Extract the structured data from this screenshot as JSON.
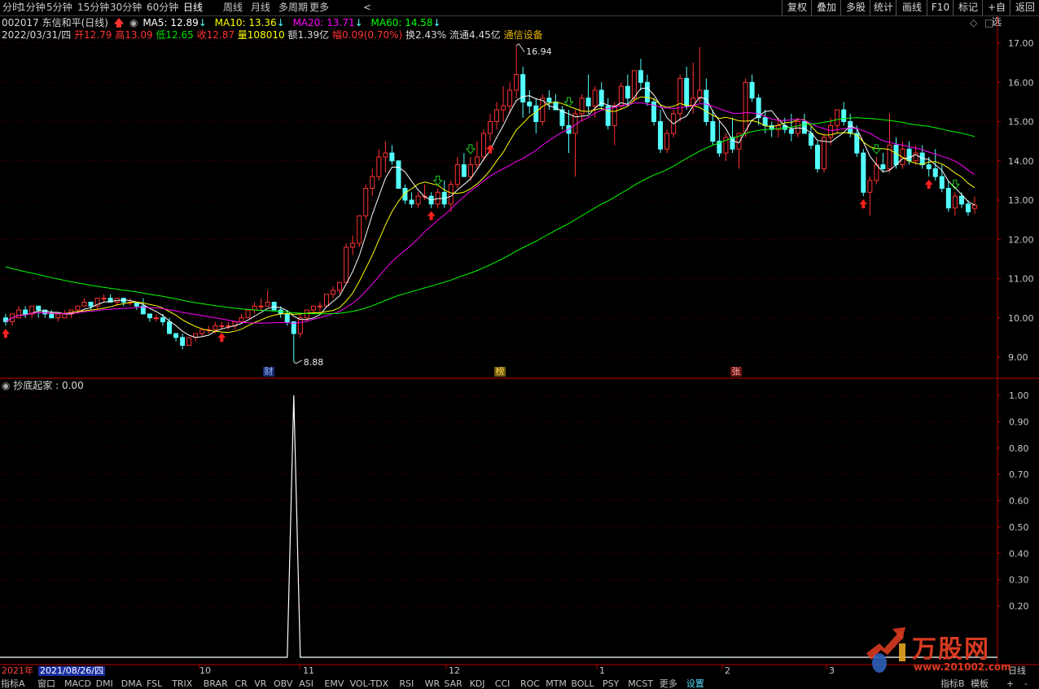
{
  "toolbar": {
    "periods": [
      "分时",
      "1分钟",
      "5分钟",
      "15分钟",
      "30分钟",
      "60分钟",
      "日线",
      "周线",
      "月线",
      "多周期",
      "更多"
    ],
    "active_period": "日线",
    "right_buttons": [
      "复权",
      "叠加",
      "多股",
      "统计",
      "画线",
      "F10",
      "标记",
      "+自选",
      "返回"
    ]
  },
  "header": {
    "title": "002017 东信和平(日线)",
    "ma5": "MA5: 12.89",
    "ma10": "MA10: 13.36",
    "ma20": "MA20: 13.71",
    "ma60": "MA60: 14.58",
    "date": "2022/03/31/四",
    "open": "开12.79",
    "high": "高13.09",
    "low": "低12.65",
    "close": "收12.87",
    "volume": "量108010",
    "amount": "额1.39亿",
    "change": "幅0.09(0.70%)",
    "turnover": "换2.43%",
    "float": "流通4.45亿",
    "industry": "通信设备"
  },
  "colors": {
    "up": "#ff3232",
    "down": "#54ffff",
    "ma5": "#ffffff",
    "ma10": "#ffff00",
    "ma20": "#ff00ff",
    "ma60": "#00ff00",
    "axis": "#c00000",
    "industry": "#e6b800"
  },
  "price_axis": [
    "17.00",
    "16.00",
    "15.00",
    "14.00",
    "13.00",
    "12.00",
    "11.00",
    "10.00",
    "9.00"
  ],
  "price_labels": {
    "high": "16.94",
    "low": "8.88"
  },
  "event_markers": [
    "财",
    "榜",
    "张"
  ],
  "indicator": {
    "title": "抄底起家 : 0.00",
    "axis": [
      "1.00",
      "0.90",
      "0.80",
      "0.70",
      "0.60",
      "0.50",
      "0.40",
      "0.30",
      "0.20"
    ]
  },
  "date_axis": {
    "year": "2021年",
    "cursor_date": "2021/08/26/四",
    "months": [
      "10",
      "11",
      "12",
      "1",
      "2",
      "3"
    ],
    "period_label": "日线"
  },
  "indicator_tabs": [
    "指标A",
    "窗口",
    "MACD",
    "DMI",
    "DMA",
    "FSL",
    "TRIX",
    "BRAR",
    "CR",
    "VR",
    "OBV",
    "ASI",
    "EMV",
    "VOL-TDX",
    "RSI",
    "WR",
    "SAR",
    "KDJ",
    "CCI",
    "ROC",
    "MTM",
    "BOLL",
    "PSY",
    "MCST",
    "更多",
    "设置"
  ],
  "right_tabs": [
    "指标B",
    "模板",
    "+",
    "-"
  ],
  "watermark": {
    "brand": "万股网",
    "url": "www.201002.com"
  },
  "chart_data": {
    "type": "candlestick",
    "title": "002017 东信和平(日线)",
    "ylim": [
      8.6,
      17.4
    ],
    "candles": [
      [
        10.0,
        10.1,
        9.8,
        9.9
      ],
      [
        9.9,
        10.1,
        9.8,
        10.1
      ],
      [
        10.0,
        10.3,
        10.0,
        10.2
      ],
      [
        10.2,
        10.3,
        10.0,
        10.1
      ],
      [
        10.1,
        10.3,
        10.0,
        10.3
      ],
      [
        10.3,
        10.3,
        10.0,
        10.2
      ],
      [
        10.2,
        10.2,
        10.0,
        10.1
      ],
      [
        10.1,
        10.2,
        10.0,
        10.0
      ],
      [
        10.0,
        10.1,
        9.9,
        10.1
      ],
      [
        10.0,
        10.2,
        10.0,
        10.1
      ],
      [
        10.1,
        10.2,
        10.0,
        10.2
      ],
      [
        10.2,
        10.3,
        10.1,
        10.3
      ],
      [
        10.3,
        10.5,
        10.3,
        10.4
      ],
      [
        10.4,
        10.4,
        10.2,
        10.3
      ],
      [
        10.3,
        10.5,
        10.2,
        10.5
      ],
      [
        10.5,
        10.6,
        10.4,
        10.5
      ],
      [
        10.5,
        10.6,
        10.4,
        10.4
      ],
      [
        10.4,
        10.5,
        10.3,
        10.5
      ],
      [
        10.5,
        10.5,
        10.3,
        10.4
      ],
      [
        10.4,
        10.5,
        10.3,
        10.4
      ],
      [
        10.4,
        10.4,
        10.2,
        10.3
      ],
      [
        10.3,
        10.5,
        10.1,
        10.1
      ],
      [
        10.1,
        10.1,
        9.9,
        10.0
      ],
      [
        10.0,
        10.1,
        9.9,
        10.0
      ],
      [
        10.0,
        10.1,
        9.8,
        9.9
      ],
      [
        9.9,
        10.0,
        9.6,
        9.6
      ],
      [
        9.6,
        9.6,
        9.4,
        9.5
      ],
      [
        9.5,
        9.6,
        9.2,
        9.3
      ],
      [
        9.3,
        9.5,
        9.3,
        9.5
      ],
      [
        9.5,
        9.6,
        9.4,
        9.6
      ],
      [
        9.6,
        9.7,
        9.5,
        9.7
      ],
      [
        9.7,
        9.8,
        9.6,
        9.7
      ],
      [
        9.7,
        9.9,
        9.6,
        9.8
      ],
      [
        9.8,
        9.9,
        9.7,
        9.8
      ],
      [
        9.8,
        9.9,
        9.7,
        9.8
      ],
      [
        9.8,
        9.9,
        9.7,
        9.9
      ],
      [
        9.9,
        10.1,
        9.9,
        10.0
      ],
      [
        10.0,
        10.2,
        10.0,
        10.2
      ],
      [
        10.2,
        10.4,
        10.1,
        10.3
      ],
      [
        10.3,
        10.5,
        10.2,
        10.3
      ],
      [
        10.3,
        10.7,
        10.3,
        10.4
      ],
      [
        10.4,
        10.4,
        10.2,
        10.2
      ],
      [
        10.2,
        10.3,
        10.0,
        10.1
      ],
      [
        10.1,
        10.2,
        9.8,
        9.9
      ],
      [
        9.9,
        9.9,
        8.88,
        9.6
      ],
      [
        9.6,
        10.1,
        9.5,
        10.0
      ],
      [
        10.0,
        10.2,
        9.9,
        10.2
      ],
      [
        10.2,
        10.3,
        10.1,
        10.3
      ],
      [
        10.3,
        10.4,
        10.1,
        10.3
      ],
      [
        10.3,
        10.6,
        10.3,
        10.6
      ],
      [
        10.6,
        10.8,
        10.5,
        10.7
      ],
      [
        10.7,
        10.9,
        10.6,
        10.9
      ],
      [
        10.9,
        11.9,
        10.9,
        11.8
      ],
      [
        11.8,
        12.1,
        11.6,
        11.9
      ],
      [
        11.9,
        12.6,
        11.8,
        12.6
      ],
      [
        12.6,
        13.4,
        12.5,
        13.3
      ],
      [
        13.3,
        13.8,
        13.1,
        13.6
      ],
      [
        13.6,
        14.3,
        13.5,
        14.1
      ],
      [
        14.1,
        14.5,
        13.7,
        14.2
      ],
      [
        14.2,
        14.4,
        13.9,
        14.0
      ],
      [
        14.0,
        14.0,
        13.3,
        13.3
      ],
      [
        13.3,
        13.4,
        12.9,
        13.0
      ],
      [
        13.0,
        13.2,
        12.8,
        12.9
      ],
      [
        12.9,
        13.2,
        12.8,
        13.1
      ],
      [
        13.1,
        13.4,
        13.0,
        13.1
      ],
      [
        13.1,
        13.2,
        12.8,
        12.9
      ],
      [
        12.9,
        13.3,
        12.8,
        13.2
      ],
      [
        13.2,
        13.5,
        12.8,
        12.9
      ],
      [
        12.9,
        13.5,
        12.7,
        13.4
      ],
      [
        13.4,
        14.1,
        13.3,
        13.9
      ],
      [
        13.9,
        14.2,
        13.6,
        13.6
      ],
      [
        13.6,
        14.1,
        13.5,
        13.9
      ],
      [
        13.9,
        14.5,
        13.8,
        14.1
      ],
      [
        14.1,
        14.8,
        14.0,
        14.7
      ],
      [
        14.7,
        15.2,
        14.5,
        15.0
      ],
      [
        15.0,
        15.5,
        14.8,
        15.3
      ],
      [
        15.3,
        15.9,
        15.0,
        15.4
      ],
      [
        15.4,
        16.0,
        15.2,
        15.8
      ],
      [
        15.8,
        16.94,
        15.6,
        16.2
      ],
      [
        16.2,
        16.4,
        15.1,
        15.5
      ],
      [
        15.5,
        15.8,
        15.2,
        15.4
      ],
      [
        15.4,
        15.6,
        14.7,
        15.0
      ],
      [
        15.0,
        15.7,
        14.9,
        15.6
      ],
      [
        15.6,
        15.8,
        15.3,
        15.5
      ],
      [
        15.5,
        15.7,
        15.3,
        15.3
      ],
      [
        15.3,
        15.4,
        14.8,
        14.9
      ],
      [
        14.9,
        15.3,
        14.2,
        14.7
      ],
      [
        14.7,
        15.3,
        13.6,
        15.2
      ],
      [
        15.2,
        15.7,
        15.0,
        15.6
      ],
      [
        15.6,
        16.2,
        15.2,
        15.4
      ],
      [
        15.4,
        15.9,
        15.1,
        15.8
      ],
      [
        15.8,
        16.0,
        15.3,
        15.4
      ],
      [
        15.4,
        15.6,
        14.8,
        14.9
      ],
      [
        14.9,
        15.5,
        14.4,
        15.4
      ],
      [
        15.4,
        16.0,
        15.3,
        15.9
      ],
      [
        15.9,
        16.2,
        15.4,
        15.6
      ],
      [
        15.6,
        16.3,
        15.5,
        16.3
      ],
      [
        16.3,
        16.6,
        15.8,
        16.0
      ],
      [
        16.0,
        16.2,
        15.4,
        15.5
      ],
      [
        15.5,
        15.6,
        14.9,
        15.0
      ],
      [
        15.0,
        15.3,
        14.2,
        14.3
      ],
      [
        14.3,
        14.8,
        14.2,
        14.7
      ],
      [
        14.7,
        15.3,
        14.6,
        15.2
      ],
      [
        15.2,
        16.2,
        15.0,
        16.1
      ],
      [
        16.1,
        16.4,
        15.3,
        15.4
      ],
      [
        15.4,
        16.5,
        15.2,
        15.6
      ],
      [
        15.6,
        16.9,
        15.5,
        15.8
      ],
      [
        15.8,
        16.1,
        14.9,
        15.0
      ],
      [
        15.0,
        15.3,
        14.4,
        14.5
      ],
      [
        14.5,
        15.0,
        14.1,
        14.2
      ],
      [
        14.2,
        14.7,
        14.0,
        14.6
      ],
      [
        14.6,
        15.1,
        14.2,
        14.3
      ],
      [
        14.3,
        14.6,
        13.8,
        14.7
      ],
      [
        14.7,
        16.1,
        14.6,
        16.0
      ],
      [
        16.0,
        16.2,
        15.5,
        15.6
      ],
      [
        15.6,
        15.7,
        14.9,
        15.1
      ],
      [
        15.1,
        15.3,
        14.7,
        14.9
      ],
      [
        14.9,
        15.0,
        14.6,
        14.8
      ],
      [
        14.8,
        15.1,
        14.6,
        14.9
      ],
      [
        14.9,
        15.1,
        14.7,
        14.8
      ],
      [
        14.8,
        15.2,
        14.5,
        14.7
      ],
      [
        14.7,
        15.1,
        14.6,
        15.0
      ],
      [
        15.0,
        15.2,
        14.7,
        14.7
      ],
      [
        14.7,
        14.9,
        14.3,
        14.4
      ],
      [
        14.4,
        14.5,
        13.7,
        13.8
      ],
      [
        13.8,
        14.7,
        13.7,
        14.6
      ],
      [
        14.6,
        15.1,
        14.4,
        14.9
      ],
      [
        14.9,
        15.3,
        14.7,
        15.3
      ],
      [
        15.3,
        15.5,
        14.9,
        15.0
      ],
      [
        15.0,
        15.2,
        14.6,
        14.7
      ],
      [
        14.7,
        14.9,
        14.1,
        14.2
      ],
      [
        14.2,
        14.3,
        13.1,
        13.2
      ],
      [
        13.2,
        13.6,
        12.6,
        13.5
      ],
      [
        13.5,
        14.1,
        13.4,
        13.9
      ],
      [
        13.9,
        14.2,
        13.7,
        13.8
      ],
      [
        13.8,
        15.2,
        13.7,
        14.4
      ],
      [
        14.4,
        14.6,
        13.8,
        13.9
      ],
      [
        13.9,
        14.5,
        13.8,
        14.3
      ],
      [
        14.3,
        14.5,
        13.9,
        14.0
      ],
      [
        14.0,
        14.4,
        13.9,
        14.2
      ],
      [
        14.2,
        14.4,
        13.8,
        13.9
      ],
      [
        13.9,
        14.1,
        13.6,
        13.8
      ],
      [
        13.8,
        14.3,
        13.5,
        13.6
      ],
      [
        13.6,
        13.9,
        13.2,
        13.3
      ],
      [
        13.3,
        13.5,
        12.7,
        12.8
      ],
      [
        12.8,
        13.2,
        12.6,
        13.1
      ],
      [
        13.1,
        13.2,
        12.8,
        12.9
      ],
      [
        12.9,
        13.0,
        12.6,
        12.7
      ],
      [
        12.79,
        13.09,
        12.65,
        12.87
      ]
    ],
    "ma_series": [
      "MA5",
      "MA10",
      "MA20",
      "MA60"
    ],
    "indicator_series": {
      "name": "抄底起家",
      "signal_index": 44,
      "signal_value": 1.0,
      "ylim": [
        0,
        1.05
      ]
    }
  }
}
